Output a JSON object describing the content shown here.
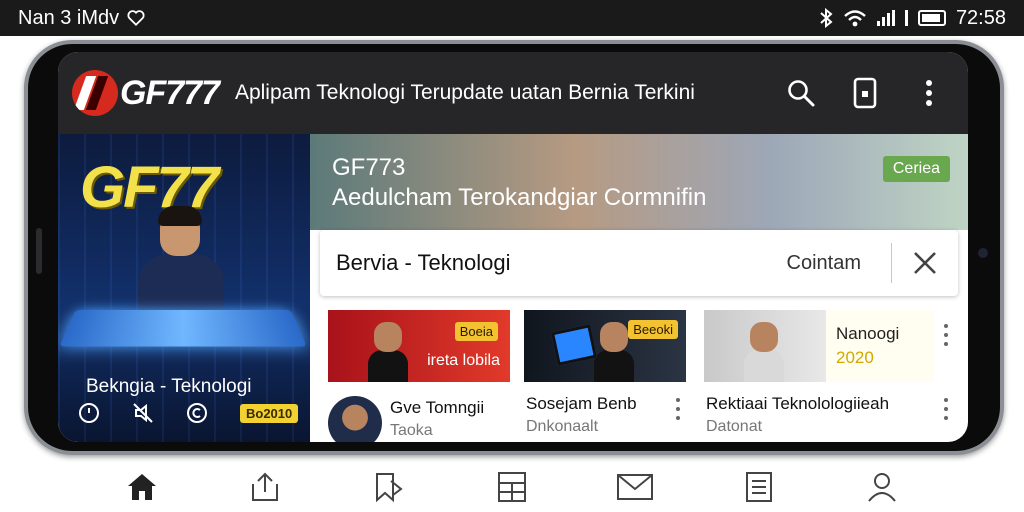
{
  "status_bar": {
    "left_text": "Nan 3 iMdv",
    "time": "72:58"
  },
  "app_bar": {
    "logo_text": "GF777",
    "title": "Aplipam Teknologi Terupdate uatan Bernia Terkini",
    "icons": [
      "search-icon",
      "phone-icon",
      "more-vert-icon"
    ]
  },
  "hero": {
    "logo": "GF77",
    "caption": "Bekngia - Teknologi",
    "badge": "Bo2010",
    "icons": [
      "clock-icon",
      "mute-icon",
      "copyright-icon"
    ]
  },
  "banner": {
    "title": "GF773",
    "subtitle": "Aedulcham Terokandgiar Cormnifin",
    "badge": "Ceriea"
  },
  "section": {
    "title": "Bervia - Teknologi",
    "link": "Cointam",
    "close_icon": "close-icon"
  },
  "cards": [
    {
      "thumb_tag": "Boeia",
      "thumb_text": "ireta lobila",
      "title": "Gve Tomngii",
      "subtitle": "Taoka"
    },
    {
      "thumb_tag": "Beeoki",
      "title": "Sosejam Benb",
      "subtitle": "Dnkonaalt"
    },
    {
      "thumb_text_1": "Nanoogi",
      "thumb_text_2": "2020",
      "title": "Rektiaai Teknolologiieah",
      "subtitle": "Datonat"
    }
  ],
  "bottom_nav": {
    "items": [
      "home-icon",
      "share-icon",
      "bookmark-icon",
      "calculator-icon",
      "mail-icon",
      "document-icon",
      "profile-icon"
    ]
  },
  "colors": {
    "app_bar_bg": "#262628",
    "accent_red": "#d62a1e",
    "accent_yellow": "#f2d230",
    "badge_green": "#6aa84f"
  }
}
